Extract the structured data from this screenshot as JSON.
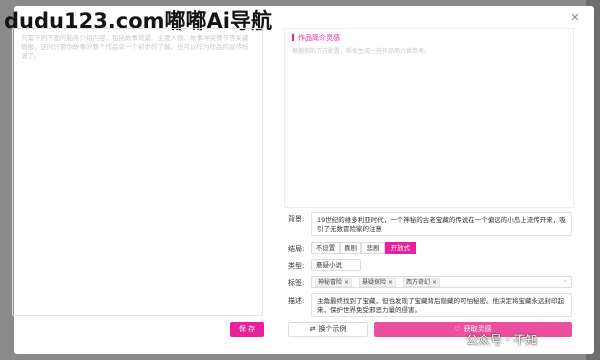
{
  "watermark_top": "dudu123.com嘟嘟Ai导航",
  "left_panel": {
    "placeholder_text": "只需下列下面的脑条介绍内容，包括故事背景、主要人物、故事冲突情节等关键情报，这时只要你故事的整个作品单一个初步的了解。也可以作为作品的宣传标语了。",
    "save_label": "保 存"
  },
  "right_panel": {
    "title": "作品简介灵感",
    "description": "根据你的下方配置，帮你生成一些作品简介供参考。"
  },
  "form": {
    "background_label": "背景:",
    "background_value": "19世纪的维多利亚时代，一个神秘的古老宝藏的传说在一个偏远的小岛上流传开来，吸引了无数冒险家的注意",
    "ending_label": "结局:",
    "ending_options": [
      "不设置",
      "喜剧",
      "悲剧",
      "开放式"
    ],
    "ending_selected": "开放式",
    "type_label": "类型:",
    "type_value": "悬疑小说",
    "tags_label": "标签:",
    "tags": [
      "神秘冒险",
      "悬疑探险",
      "西方奇幻"
    ],
    "description_label": "描述:",
    "description_value": "主角最终找到了宝藏，但也发现了宝藏背后隐藏的可怕秘密。他决定将宝藏永远封印起来，保护世界免受邪恶力量的侵害。"
  },
  "actions": {
    "example_label": "换个示例",
    "fetch_label": "获取灵感"
  },
  "watermark_bottom": "公众号 · 不知"
}
